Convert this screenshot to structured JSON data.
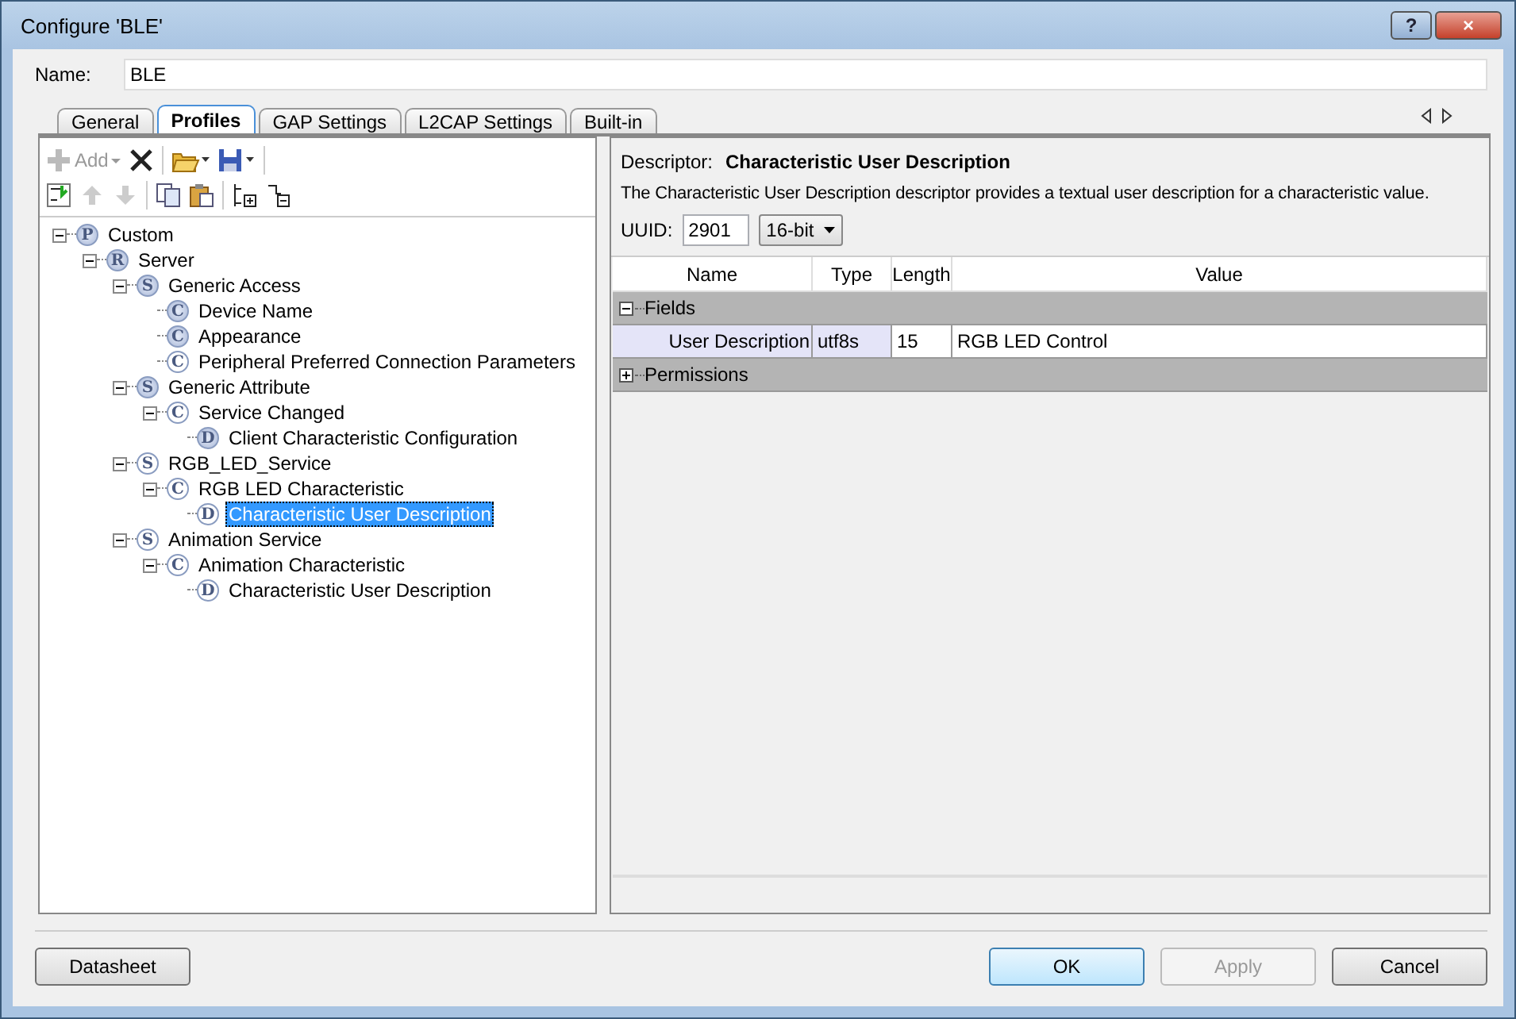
{
  "window": {
    "title": "Configure 'BLE'",
    "buttons": [
      "?",
      "×"
    ]
  },
  "name": {
    "label": "Name:",
    "value": "BLE"
  },
  "tabs": [
    {
      "label": "General",
      "selected": false
    },
    {
      "label": "Profiles",
      "selected": true
    },
    {
      "label": "GAP Settings",
      "selected": false
    },
    {
      "label": "L2CAP Settings",
      "selected": false
    },
    {
      "label": "Built-in",
      "selected": false
    }
  ],
  "toolbar": {
    "add_label": "Add",
    "add_disabled": true
  },
  "tree": [
    {
      "badge": "P",
      "label": "Custom",
      "filled": true,
      "expanded": true,
      "selected": false,
      "children": [
        {
          "badge": "R",
          "label": "Server",
          "filled": true,
          "expanded": true,
          "selected": false,
          "children": [
            {
              "badge": "S",
              "label": "Generic Access",
              "filled": true,
              "expanded": true,
              "selected": false,
              "children": [
                {
                  "badge": "C",
                  "label": "Device Name",
                  "filled": true,
                  "selected": false
                },
                {
                  "badge": "C",
                  "label": "Appearance",
                  "filled": true,
                  "selected": false
                },
                {
                  "badge": "C",
                  "label": "Peripheral Preferred Connection Parameters",
                  "filled": false,
                  "selected": false
                }
              ]
            },
            {
              "badge": "S",
              "label": "Generic Attribute",
              "filled": true,
              "expanded": true,
              "selected": false,
              "children": [
                {
                  "badge": "C",
                  "label": "Service Changed",
                  "filled": false,
                  "expanded": true,
                  "selected": false,
                  "children": [
                    {
                      "badge": "D",
                      "label": "Client Characteristic Configuration",
                      "filled": true,
                      "selected": false
                    }
                  ]
                }
              ]
            },
            {
              "badge": "S",
              "label": "RGB_LED_Service",
              "filled": false,
              "expanded": true,
              "selected": false,
              "children": [
                {
                  "badge": "C",
                  "label": "RGB LED Characteristic",
                  "filled": false,
                  "expanded": true,
                  "selected": false,
                  "children": [
                    {
                      "badge": "D",
                      "label": "Characteristic User Description",
                      "filled": false,
                      "selected": true
                    }
                  ]
                }
              ]
            },
            {
              "badge": "S",
              "label": "Animation Service",
              "filled": false,
              "expanded": true,
              "selected": false,
              "children": [
                {
                  "badge": "C",
                  "label": "Animation Characteristic",
                  "filled": false,
                  "expanded": true,
                  "selected": false,
                  "children": [
                    {
                      "badge": "D",
                      "label": "Characteristic User Description",
                      "filled": false,
                      "selected": false
                    }
                  ]
                }
              ]
            }
          ]
        }
      ]
    }
  ],
  "descriptor": {
    "label": "Descriptor:",
    "title": "Characteristic User Description",
    "description": "The Characteristic User Description descriptor provides a textual user description for a characteristic value.",
    "uuid_label": "UUID:",
    "uuid": "2901",
    "uuid_size": "16-bit"
  },
  "grid": {
    "columns": [
      "Name",
      "Type",
      "Length",
      "Value"
    ],
    "groups": [
      {
        "label": "Fields",
        "expanded": true,
        "rows": [
          {
            "name": "User Description",
            "type": "utf8s",
            "length": "15",
            "value": "RGB LED Control"
          }
        ]
      },
      {
        "label": "Permissions",
        "expanded": false
      }
    ]
  },
  "footer": {
    "left": [
      {
        "label": "Datasheet",
        "disabled": false,
        "default": false
      }
    ],
    "right": [
      {
        "label": "OK",
        "disabled": false,
        "default": true
      },
      {
        "label": "Apply",
        "disabled": true,
        "default": false
      },
      {
        "label": "Cancel",
        "disabled": false,
        "default": false
      }
    ]
  }
}
